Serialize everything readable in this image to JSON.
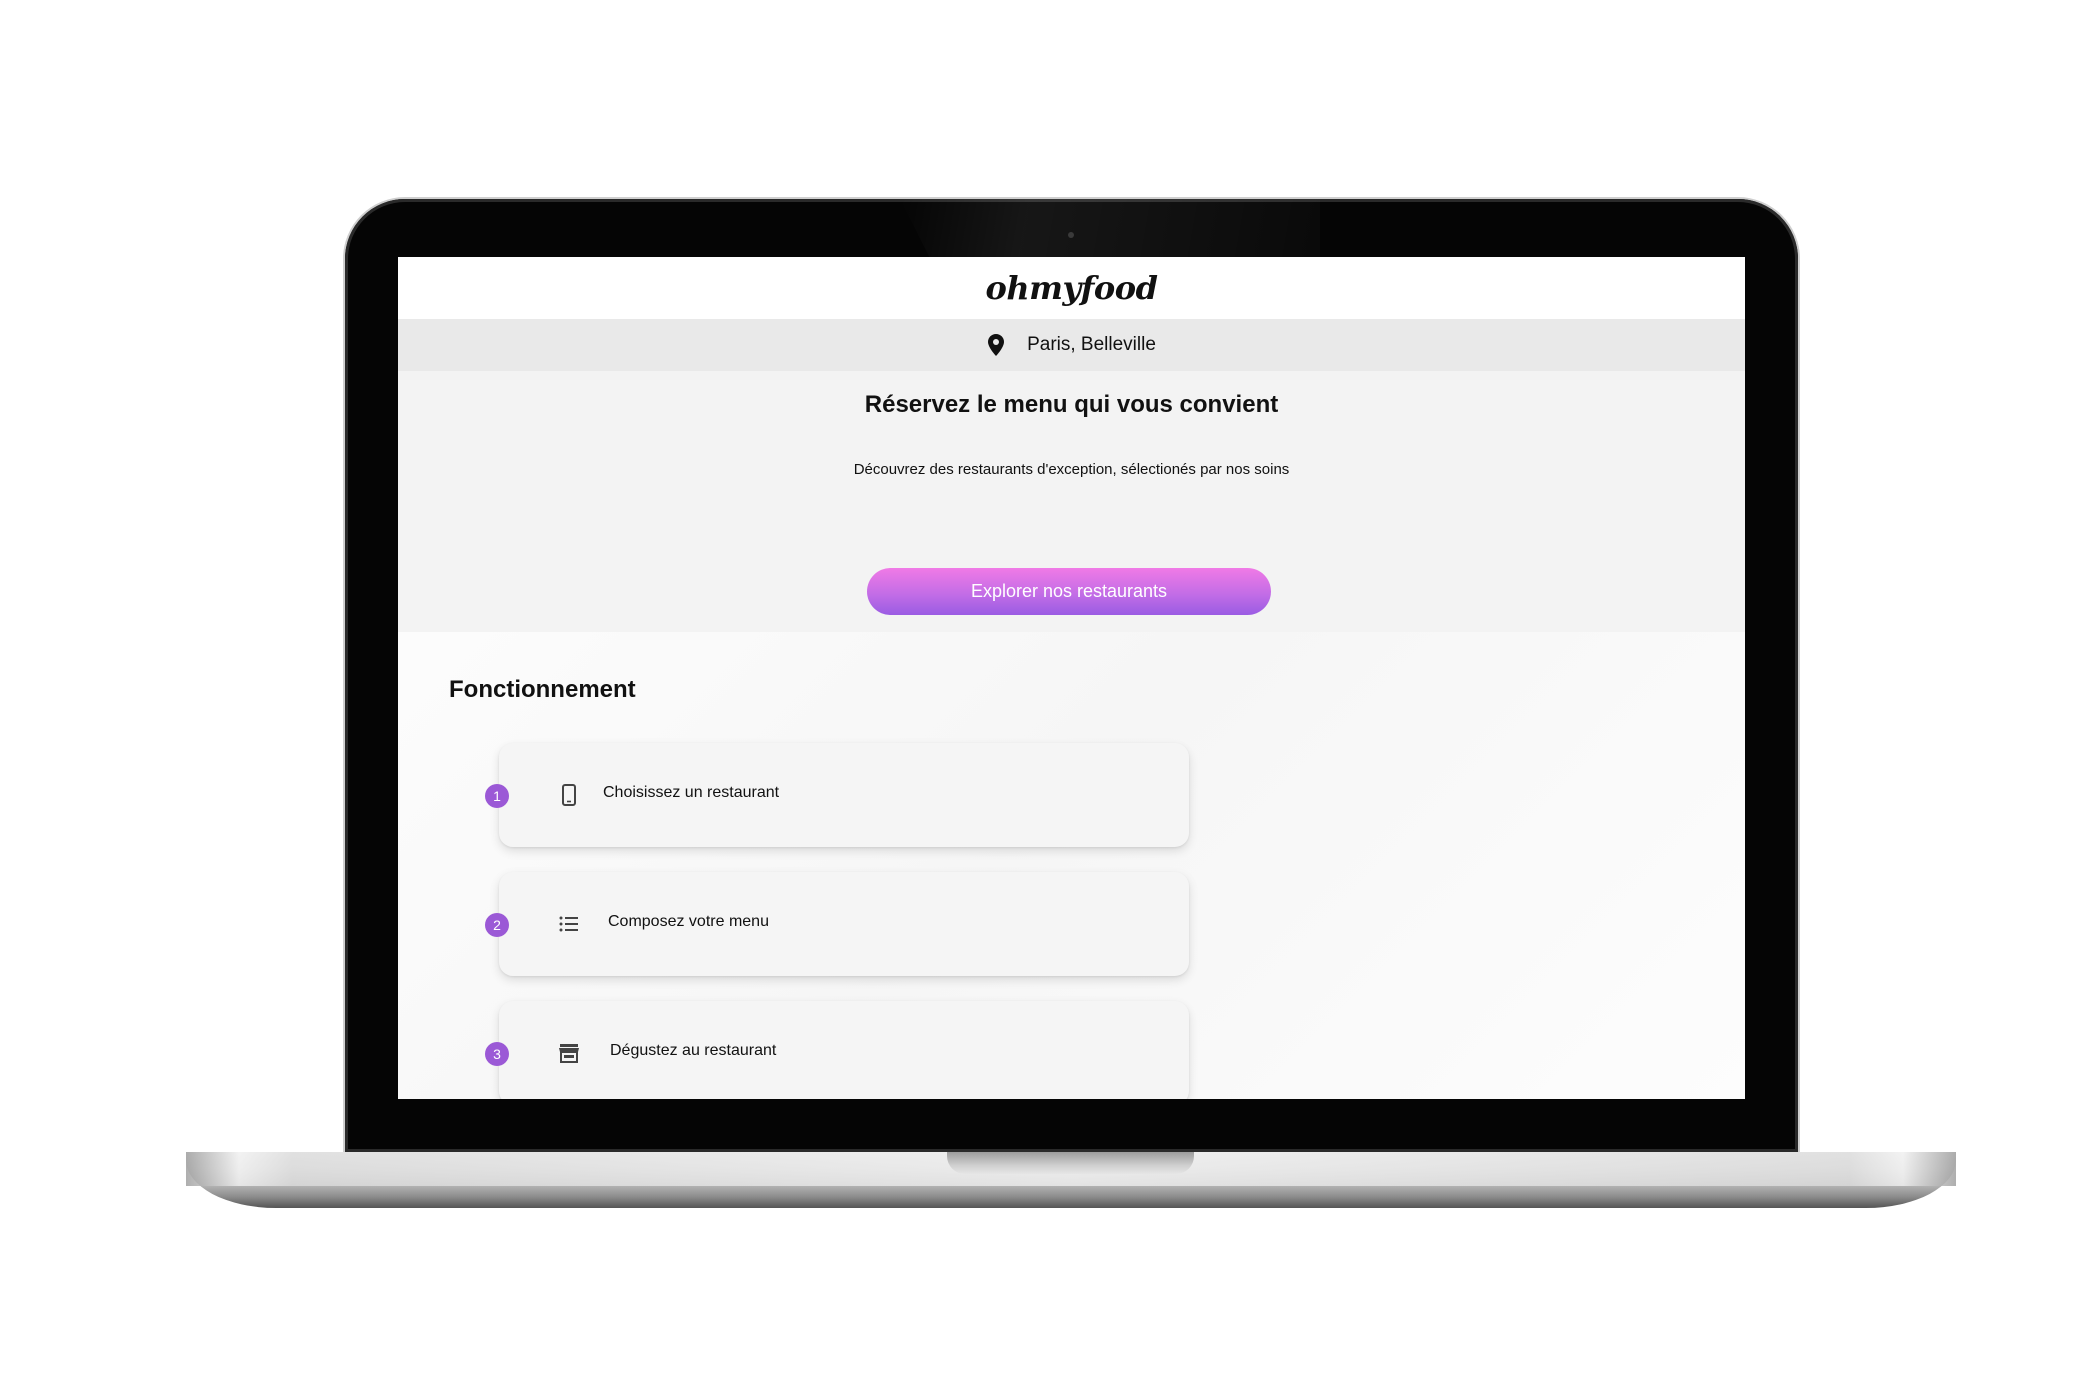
{
  "site": {
    "logo": "ohmyfood"
  },
  "location": {
    "icon": "map-pin-icon",
    "text": "Paris, Belleville"
  },
  "hero": {
    "title": "Réservez le menu qui vous convient",
    "subtitle": "Découvrez des restaurants d'exception, sélectionés par nos soins",
    "cta_label": "Explorer nos restaurants"
  },
  "how_it_works": {
    "title": "Fonctionnement",
    "steps": [
      {
        "number": "1",
        "icon": "smartphone-icon",
        "label": "Choisissez un restaurant"
      },
      {
        "number": "2",
        "icon": "list-icon",
        "label": "Composez votre menu"
      },
      {
        "number": "3",
        "icon": "storefront-icon",
        "label": "Dégustez au restaurant"
      }
    ]
  },
  "colors": {
    "accent_start": "#f07ae6",
    "accent_end": "#9a5ce3",
    "step_badge": "#9b59d6"
  }
}
